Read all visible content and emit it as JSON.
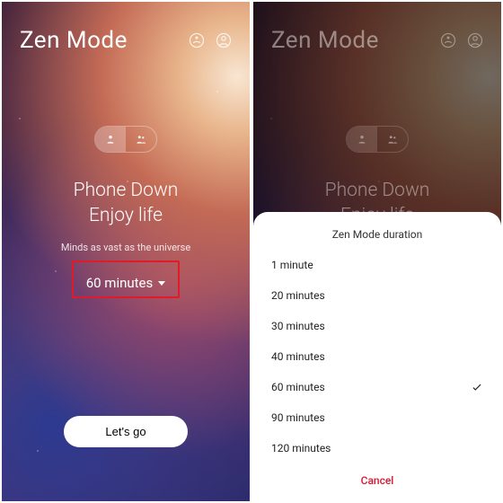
{
  "app_title": "Zen Mode",
  "headline_1": "Phone Down",
  "headline_2": "Enjoy life",
  "subtitle": "Minds as vast as the universe",
  "selected_duration_label": "60 minutes",
  "cta_label": "Let's go",
  "sheet": {
    "title": "Zen Mode duration",
    "options": [
      "1 minute",
      "20 minutes",
      "30 minutes",
      "40 minutes",
      "60 minutes",
      "90 minutes",
      "120 minutes"
    ],
    "selected_index": 4,
    "cancel_label": "Cancel"
  },
  "icons": {
    "meditation": "meditation-icon",
    "profile": "profile-icon",
    "solo": "person-icon",
    "group": "group-icon",
    "chevron_down": "chevron-down-icon",
    "check": "check-icon"
  }
}
